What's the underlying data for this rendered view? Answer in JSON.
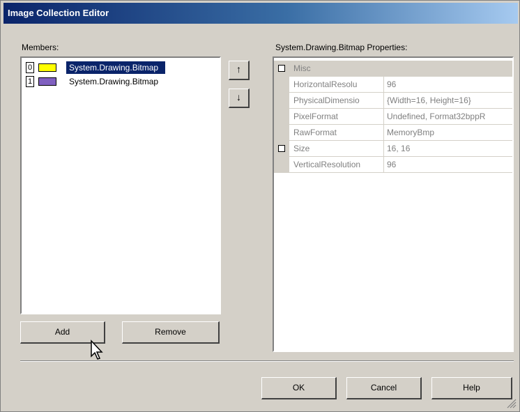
{
  "window": {
    "title": "Image Collection Editor"
  },
  "members": {
    "label": "Members:",
    "items": [
      {
        "index": "0",
        "name": "System.Drawing.Bitmap",
        "color": "#ffff00",
        "selected": true
      },
      {
        "index": "1",
        "name": "System.Drawing.Bitmap",
        "color": "#8060c0",
        "selected": false
      }
    ]
  },
  "move_up_label": "↑",
  "move_down_label": "↓",
  "add_label": "Add",
  "remove_label": "Remove",
  "properties": {
    "label": "System.Drawing.Bitmap Properties:",
    "category": "Misc",
    "rows": [
      {
        "name": "HorizontalResolu",
        "value": "96"
      },
      {
        "name": "PhysicalDimensio",
        "value": "{Width=16, Height=16}"
      },
      {
        "name": "PixelFormat",
        "value": "Undefined, Format32bppR"
      },
      {
        "name": "RawFormat",
        "value": "MemoryBmp"
      },
      {
        "name": "Size",
        "value": "16, 16",
        "expandable": true
      },
      {
        "name": "VerticalResolution",
        "value": "96"
      }
    ]
  },
  "ok_label": "OK",
  "cancel_label": "Cancel",
  "help_label": "Help"
}
